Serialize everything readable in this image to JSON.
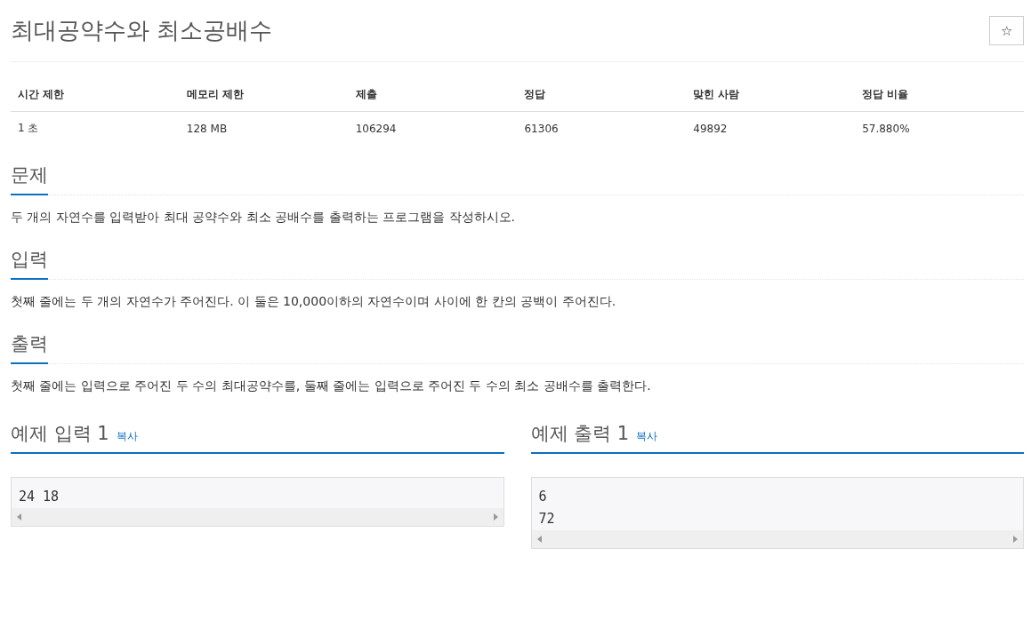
{
  "title": "최대공약수와 최소공배수",
  "star_button": {
    "label": "☆"
  },
  "info_table": {
    "columns": [
      "시간 제한",
      "메모리 제한",
      "제출",
      "정답",
      "맞힌 사람",
      "정답 비율"
    ],
    "rows": [
      [
        "1 초",
        "128 MB",
        "106294",
        "61306",
        "49892",
        "57.880%"
      ]
    ]
  },
  "sections": [
    {
      "heading": "문제",
      "text": "두 개의 자연수를 입력받아 최대 공약수와 최소 공배수를 출력하는 프로그램을 작성하시오."
    },
    {
      "heading": "입력",
      "text": "첫째 줄에는 두 개의 자연수가 주어진다. 이 둘은 10,000이하의 자연수이며 사이에 한 칸의 공백이 주어진다."
    },
    {
      "heading": "출력",
      "text": "첫째 줄에는 입력으로 주어진 두 수의 최대공약수를, 둘째 줄에는 입력으로 주어진 두 수의 최소 공배수를 출력한다."
    }
  ],
  "samples": [
    {
      "heading": "예제 입력 1",
      "copy_link": "복사",
      "lines": [
        "24 18"
      ]
    },
    {
      "heading": "예제 출력 1",
      "copy_link": "복사",
      "lines": [
        "6",
        "72"
      ]
    }
  ]
}
